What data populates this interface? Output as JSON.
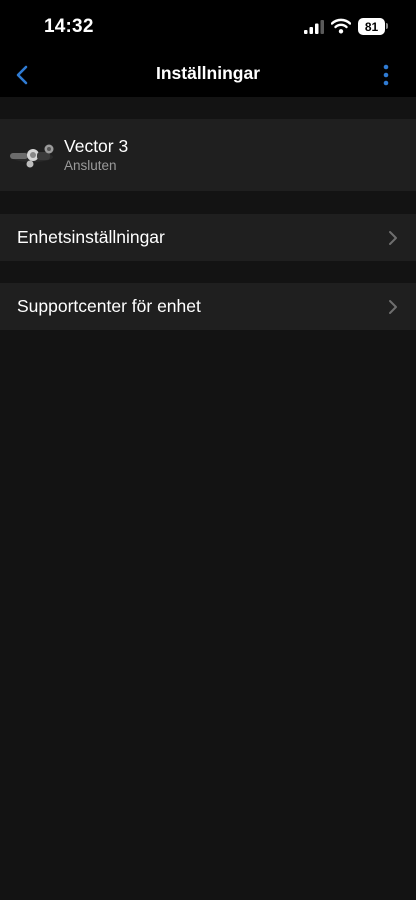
{
  "status_bar": {
    "time": "14:32",
    "battery": "81",
    "icons": [
      "cellular-signal-icon",
      "wifi-icon",
      "battery-icon"
    ]
  },
  "nav": {
    "title": "Inställningar",
    "back_icon": "chevron-left-icon",
    "more_icon": "more-vertical-icon"
  },
  "device": {
    "name": "Vector 3",
    "status": "Ansluten"
  },
  "menu": {
    "items": [
      {
        "label": "Enhetsinställningar",
        "icon": "chevron-right-icon"
      },
      {
        "label": "Supportcenter för enhet",
        "icon": "chevron-right-icon"
      }
    ]
  },
  "colors": {
    "background": "#131313",
    "bars": "#000000",
    "row": "#1f1f1f",
    "accent": "#2f7bd3",
    "secondary_text": "#9a9a9a"
  }
}
